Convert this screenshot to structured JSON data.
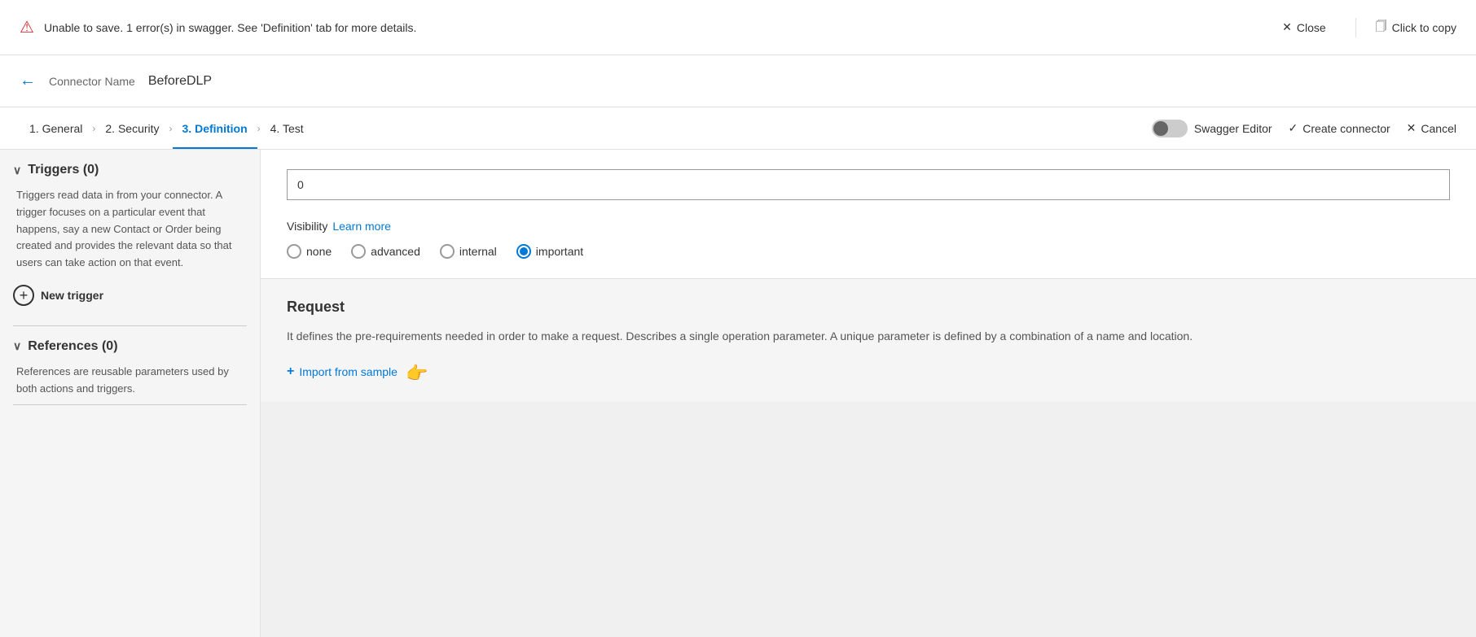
{
  "error_banner": {
    "message": "Unable to save. 1 error(s) in swagger. See 'Definition' tab for more details.",
    "close_label": "Close",
    "copy_label": "Click to copy"
  },
  "header": {
    "connector_name_label": "Connector Name",
    "connector_name_value": "BeforeDLP",
    "back_icon": "←"
  },
  "nav": {
    "tabs": [
      {
        "id": "general",
        "label": "1. General"
      },
      {
        "id": "security",
        "label": "2. Security"
      },
      {
        "id": "definition",
        "label": "3. Definition"
      },
      {
        "id": "test",
        "label": "4. Test"
      }
    ],
    "active_tab": "definition",
    "swagger_editor_label": "Swagger Editor",
    "create_connector_label": "Create connector",
    "cancel_label": "Cancel"
  },
  "sidebar": {
    "triggers_header": "Triggers (0)",
    "triggers_desc": "Triggers read data in from your connector. A trigger focuses on a particular event that happens, say a new Contact or Order being created and provides the relevant data so that users can take action on that event.",
    "new_trigger_label": "New trigger",
    "references_header": "References (0)",
    "references_desc": "References are reusable parameters used by both actions and triggers."
  },
  "main": {
    "input_value": "0",
    "visibility_label": "Visibility",
    "learn_more_label": "Learn more",
    "radio_options": [
      {
        "id": "none",
        "label": "none",
        "selected": false
      },
      {
        "id": "advanced",
        "label": "advanced",
        "selected": false
      },
      {
        "id": "internal",
        "label": "internal",
        "selected": false
      },
      {
        "id": "important",
        "label": "important",
        "selected": true
      }
    ],
    "request_title": "Request",
    "request_desc": "It defines the pre-requirements needed in order to make a request. Describes a single operation parameter. A unique parameter is defined by a combination of a name and location.",
    "import_label": "Import from sample"
  }
}
